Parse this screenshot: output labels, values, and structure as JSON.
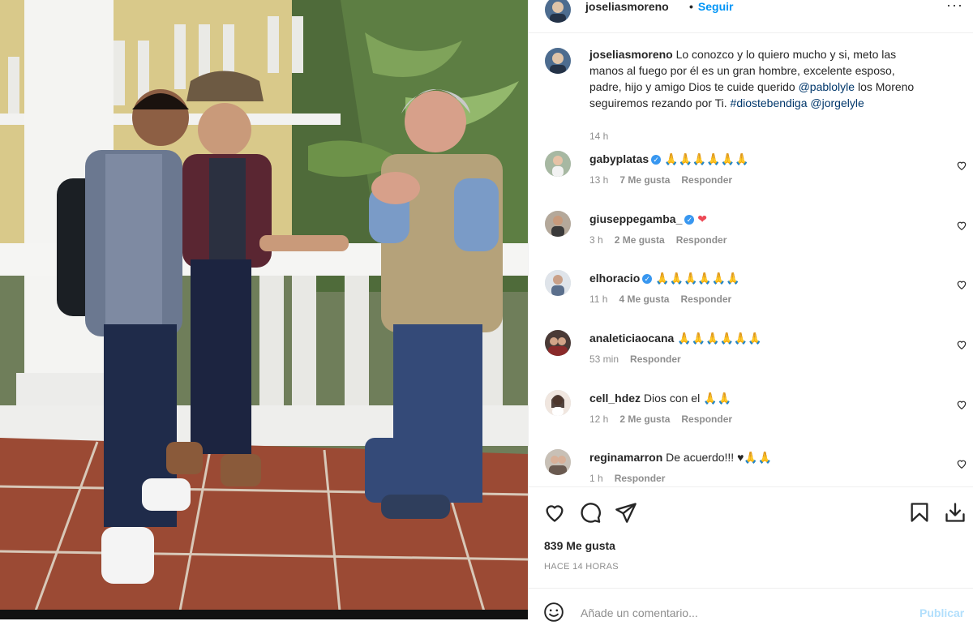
{
  "post": {
    "username": "joseliasmoreno",
    "follow_label": "Seguir",
    "more_label": "···",
    "caption_text": "Lo conozco y lo quiero mucho y si, meto las manos al fuego por él es un gran hombre, excelente esposo, padre, hijo y amigo Dios te cuide querido ",
    "caption_mention1": "@pablolyle",
    "caption_mid": " los Moreno seguiremos rezando por Ti. ",
    "caption_hashtag": "#diostebendiga",
    "caption_mention2": "@jorgelyle",
    "caption_time": "14 h"
  },
  "comments": [
    {
      "user": "gabyplatas",
      "verified": true,
      "text": "🙏🙏🙏🙏🙏🙏",
      "time": "13 h",
      "likes": "7 Me gusta",
      "reply": "Responder"
    },
    {
      "user": "giuseppegamba_",
      "verified": true,
      "text": "❤",
      "time": "3 h",
      "likes": "2 Me gusta",
      "reply": "Responder"
    },
    {
      "user": "elhoracio",
      "verified": true,
      "text": "🙏🙏🙏🙏🙏🙏",
      "time": "11 h",
      "likes": "4 Me gusta",
      "reply": "Responder"
    },
    {
      "user": "analeticiaocana",
      "verified": false,
      "text": "🙏🙏🙏🙏🙏🙏",
      "time": "53 min",
      "likes": "",
      "reply": "Responder"
    },
    {
      "user": "cell_hdez",
      "verified": false,
      "text": "Dios con el 🙏🙏",
      "time": "12 h",
      "likes": "2 Me gusta",
      "reply": "Responder"
    },
    {
      "user": "reginamarron",
      "verified": false,
      "text": "De acuerdo!!! ♥🙏🙏",
      "time": "1 h",
      "likes": "",
      "reply": "Responder"
    }
  ],
  "stats": {
    "likes": "839 Me gusta",
    "when": "HACE 14 HORAS"
  },
  "add_comment": {
    "placeholder": "Añade un comentario...",
    "publish_label": "Publicar"
  },
  "icons": {
    "like": "heart-icon",
    "comment": "comment-icon",
    "share": "paper-plane-icon",
    "save": "bookmark-icon",
    "download": "download-icon",
    "emoji": "emoji-icon",
    "more": "more-options-icon",
    "verified": "verified-badge-icon"
  },
  "colors": {
    "link": "#00376b",
    "accent": "#0095f6",
    "verified": "#3897f0",
    "muted": "#8e8e8e",
    "heart_red": "#ed4956",
    "publish_disabled": "#b2dffc"
  }
}
